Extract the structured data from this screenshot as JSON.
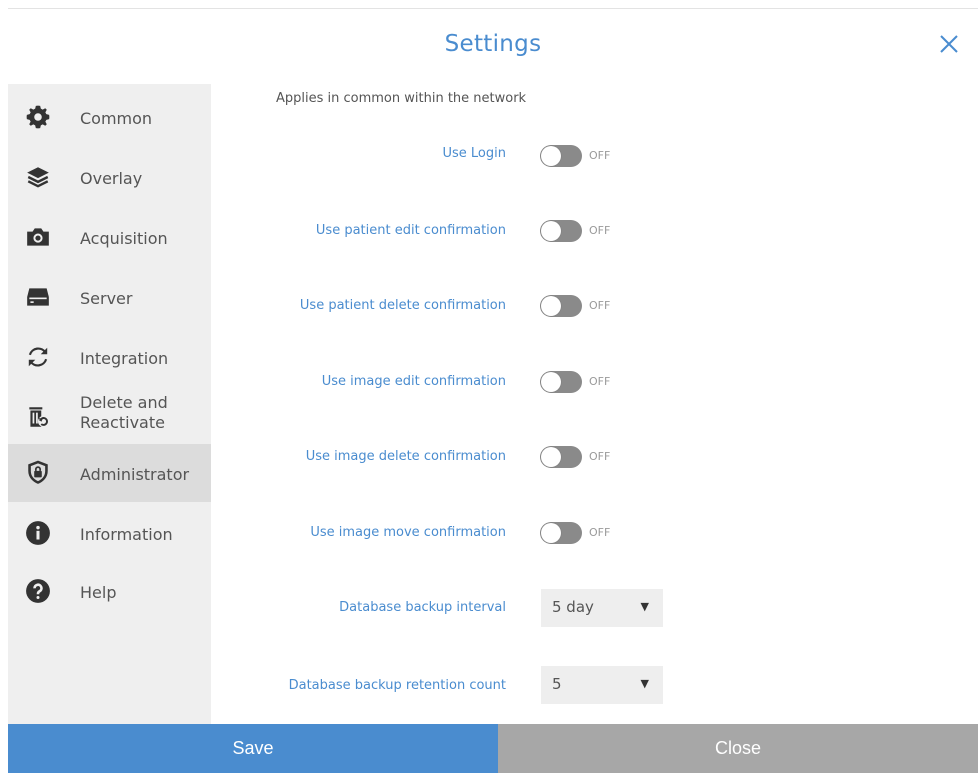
{
  "dialog": {
    "title": "Settings"
  },
  "sidebar": {
    "items": [
      {
        "label": "Common",
        "icon": "gear-icon"
      },
      {
        "label": "Overlay",
        "icon": "layers-icon"
      },
      {
        "label": "Acquisition",
        "icon": "camera-icon"
      },
      {
        "label": "Server",
        "icon": "server-icon"
      },
      {
        "label": "Integration",
        "icon": "sync-icon"
      },
      {
        "label_line1": "Delete and",
        "label_line2": "Reactivate",
        "icon": "restore-bin-icon"
      },
      {
        "label": "Administrator",
        "icon": "shield-lock-icon",
        "active": true
      },
      {
        "label": "Information",
        "icon": "info-icon"
      },
      {
        "label": "Help",
        "icon": "help-icon"
      }
    ]
  },
  "main": {
    "description": "Applies in common within the network",
    "toggles": [
      {
        "label": "Use Login",
        "state": "OFF"
      },
      {
        "label": "Use patient edit confirmation",
        "state": "OFF"
      },
      {
        "label": "Use patient delete confirmation",
        "state": "OFF"
      },
      {
        "label": "Use image edit confirmation",
        "state": "OFF"
      },
      {
        "label": "Use image delete confirmation",
        "state": "OFF"
      },
      {
        "label": "Use image move confirmation",
        "state": "OFF"
      }
    ],
    "selects": [
      {
        "label": "Database backup interval",
        "value": "5 day"
      },
      {
        "label": "Database backup retention count",
        "value": "5"
      }
    ]
  },
  "footer": {
    "save_label": "Save",
    "close_label": "Close"
  },
  "colors": {
    "accent": "#4a8ccf",
    "sidebar_bg": "#efefef",
    "sidebar_active": "#dcdcdc",
    "close_bg": "#a7a7a7",
    "toggle_off": "#8a8a8a"
  }
}
